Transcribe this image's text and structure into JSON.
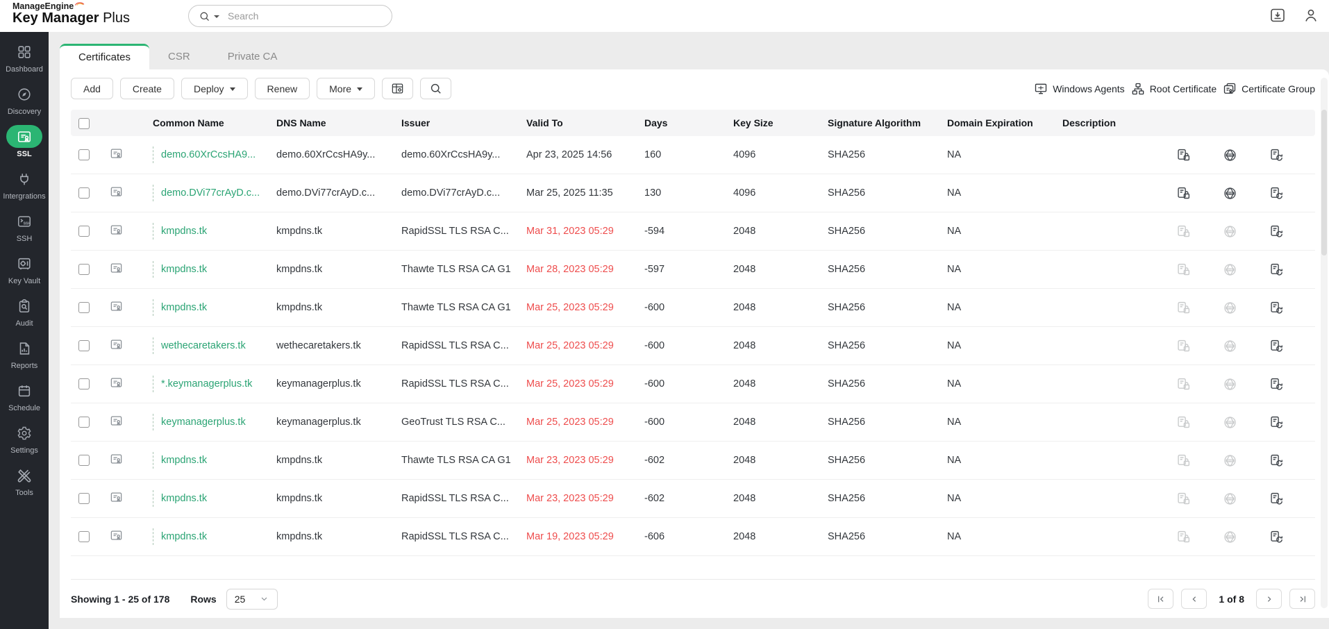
{
  "brand": {
    "company": "ManageEngine",
    "product_bold": "Key Manager",
    "product_light": "Plus"
  },
  "topbar": {
    "search_placeholder": "Search"
  },
  "sidebar": {
    "items": [
      {
        "id": "dashboard",
        "label": "Dashboard",
        "icon": "dashboard",
        "active": false
      },
      {
        "id": "discovery",
        "label": "Discovery",
        "icon": "discovery",
        "active": false
      },
      {
        "id": "ssl",
        "label": "SSL",
        "icon": "ssl",
        "active": true
      },
      {
        "id": "integrations",
        "label": "Intergrations",
        "icon": "integrations",
        "active": false
      },
      {
        "id": "ssh",
        "label": "SSH",
        "icon": "ssh",
        "active": false
      },
      {
        "id": "key-vault",
        "label": "Key Vault",
        "icon": "key-vault",
        "active": false
      },
      {
        "id": "audit",
        "label": "Audit",
        "icon": "audit",
        "active": false
      },
      {
        "id": "reports",
        "label": "Reports",
        "icon": "reports",
        "active": false
      },
      {
        "id": "schedule",
        "label": "Schedule",
        "icon": "schedule",
        "active": false
      },
      {
        "id": "settings",
        "label": "Settings",
        "icon": "settings",
        "active": false
      },
      {
        "id": "tools",
        "label": "Tools",
        "icon": "tools",
        "active": false
      }
    ]
  },
  "tabs": [
    {
      "label": "Certificates",
      "active": true
    },
    {
      "label": "CSR",
      "active": false
    },
    {
      "label": "Private CA",
      "active": false
    }
  ],
  "toolbar": {
    "add": "Add",
    "create": "Create",
    "deploy": "Deploy",
    "renew": "Renew",
    "more": "More"
  },
  "quick_links": [
    {
      "label": "Windows Agents",
      "icon": "windows-agents"
    },
    {
      "label": "Root Certificate",
      "icon": "root-certificate"
    },
    {
      "label": "Certificate Group",
      "icon": "certificate-group"
    }
  ],
  "table": {
    "columns": [
      "Common Name",
      "DNS Name",
      "Issuer",
      "Valid To",
      "Days",
      "Key Size",
      "Signature Algorithm",
      "Domain Expiration",
      "Description"
    ],
    "rows": [
      {
        "common_name": "demo.60XrCcsHA9...",
        "dns_name": "demo.60XrCcsHA9y...",
        "issuer": "demo.60XrCcsHA9y...",
        "valid_to": "Apr 23, 2025 14:56",
        "expired": false,
        "days": "160",
        "key_size": "4096",
        "signature_algorithm": "SHA256",
        "domain_expiration": "NA",
        "description": "",
        "actions_enabled": true
      },
      {
        "common_name": "demo.DVi77crAyD.c...",
        "dns_name": "demo.DVi77crAyD.c...",
        "issuer": "demo.DVi77crAyD.c...",
        "valid_to": "Mar 25, 2025 11:35",
        "expired": false,
        "days": "130",
        "key_size": "4096",
        "signature_algorithm": "SHA256",
        "domain_expiration": "NA",
        "description": "",
        "actions_enabled": true
      },
      {
        "common_name": "kmpdns.tk",
        "dns_name": "kmpdns.tk",
        "issuer": "RapidSSL TLS RSA C...",
        "valid_to": "Mar 31, 2023 05:29",
        "expired": true,
        "days": "-594",
        "key_size": "2048",
        "signature_algorithm": "SHA256",
        "domain_expiration": "NA",
        "description": "",
        "actions_enabled": false
      },
      {
        "common_name": "kmpdns.tk",
        "dns_name": "kmpdns.tk",
        "issuer": "Thawte TLS RSA CA G1",
        "valid_to": "Mar 28, 2023 05:29",
        "expired": true,
        "days": "-597",
        "key_size": "2048",
        "signature_algorithm": "SHA256",
        "domain_expiration": "NA",
        "description": "",
        "actions_enabled": false
      },
      {
        "common_name": "kmpdns.tk",
        "dns_name": "kmpdns.tk",
        "issuer": "Thawte TLS RSA CA G1",
        "valid_to": "Mar 25, 2023 05:29",
        "expired": true,
        "days": "-600",
        "key_size": "2048",
        "signature_algorithm": "SHA256",
        "domain_expiration": "NA",
        "description": "",
        "actions_enabled": false
      },
      {
        "common_name": "wethecaretakers.tk",
        "dns_name": "wethecaretakers.tk",
        "issuer": "RapidSSL TLS RSA C...",
        "valid_to": "Mar 25, 2023 05:29",
        "expired": true,
        "days": "-600",
        "key_size": "2048",
        "signature_algorithm": "SHA256",
        "domain_expiration": "NA",
        "description": "",
        "actions_enabled": false
      },
      {
        "common_name": "*.keymanagerplus.tk",
        "dns_name": "keymanagerplus.tk",
        "issuer": "RapidSSL TLS RSA C...",
        "valid_to": "Mar 25, 2023 05:29",
        "expired": true,
        "days": "-600",
        "key_size": "2048",
        "signature_algorithm": "SHA256",
        "domain_expiration": "NA",
        "description": "",
        "actions_enabled": false
      },
      {
        "common_name": "keymanagerplus.tk",
        "dns_name": "keymanagerplus.tk",
        "issuer": "GeoTrust TLS RSA C...",
        "valid_to": "Mar 25, 2023 05:29",
        "expired": true,
        "days": "-600",
        "key_size": "2048",
        "signature_algorithm": "SHA256",
        "domain_expiration": "NA",
        "description": "",
        "actions_enabled": false
      },
      {
        "common_name": "kmpdns.tk",
        "dns_name": "kmpdns.tk",
        "issuer": "Thawte TLS RSA CA G1",
        "valid_to": "Mar 23, 2023 05:29",
        "expired": true,
        "days": "-602",
        "key_size": "2048",
        "signature_algorithm": "SHA256",
        "domain_expiration": "NA",
        "description": "",
        "actions_enabled": false
      },
      {
        "common_name": "kmpdns.tk",
        "dns_name": "kmpdns.tk",
        "issuer": "RapidSSL TLS RSA C...",
        "valid_to": "Mar 23, 2023 05:29",
        "expired": true,
        "days": "-602",
        "key_size": "2048",
        "signature_algorithm": "SHA256",
        "domain_expiration": "NA",
        "description": "",
        "actions_enabled": false
      },
      {
        "common_name": "kmpdns.tk",
        "dns_name": "kmpdns.tk",
        "issuer": "RapidSSL TLS RSA C...",
        "valid_to": "Mar 19, 2023 05:29",
        "expired": true,
        "days": "-606",
        "key_size": "2048",
        "signature_algorithm": "SHA256",
        "domain_expiration": "NA",
        "description": "",
        "actions_enabled": false
      }
    ]
  },
  "footer": {
    "showing": "Showing 1 - 25 of 178",
    "rows_label": "Rows",
    "rows_per_page": "25",
    "page_status": "1 of 8"
  },
  "colors": {
    "accent_green": "#2bb573",
    "link_green": "#2ba474",
    "expired_red": "#ee4d4d",
    "sidebar_bg": "#23262c"
  }
}
